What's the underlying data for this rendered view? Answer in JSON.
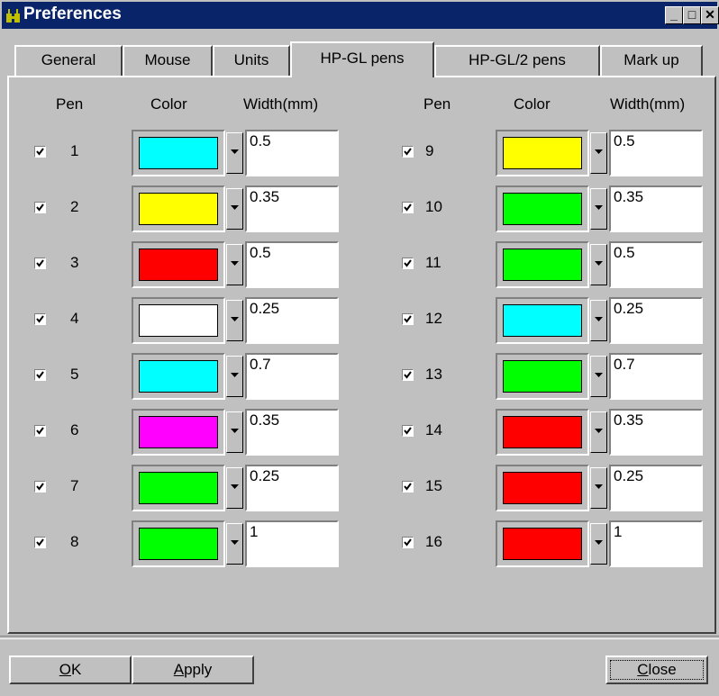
{
  "window": {
    "title": "Preferences"
  },
  "title_buttons": {
    "minimize": "_",
    "maximize": "□",
    "close": "✕"
  },
  "tabs": [
    {
      "label": "General",
      "active": false
    },
    {
      "label": "Mouse",
      "active": false
    },
    {
      "label": "Units",
      "active": false
    },
    {
      "label": "HP-GL pens",
      "active": true
    },
    {
      "label": "HP-GL/2 pens",
      "active": false
    },
    {
      "label": "Mark up",
      "active": false
    }
  ],
  "headers": {
    "pen": "Pen",
    "color": "Color",
    "width": "Width(mm)"
  },
  "pens_left": [
    {
      "num": "1",
      "checked": true,
      "color": "#00ffff",
      "width": "0.5"
    },
    {
      "num": "2",
      "checked": true,
      "color": "#ffff00",
      "width": "0.35"
    },
    {
      "num": "3",
      "checked": true,
      "color": "#ff0000",
      "width": "0.5"
    },
    {
      "num": "4",
      "checked": true,
      "color": "#ffffff",
      "width": "0.25"
    },
    {
      "num": "5",
      "checked": true,
      "color": "#00ffff",
      "width": "0.7"
    },
    {
      "num": "6",
      "checked": true,
      "color": "#ff00ff",
      "width": "0.35"
    },
    {
      "num": "7",
      "checked": true,
      "color": "#00ff00",
      "width": "0.25"
    },
    {
      "num": "8",
      "checked": true,
      "color": "#00ff00",
      "width": "1"
    }
  ],
  "pens_right": [
    {
      "num": "9",
      "checked": true,
      "color": "#ffff00",
      "width": "0.5"
    },
    {
      "num": "10",
      "checked": true,
      "color": "#00ff00",
      "width": "0.35"
    },
    {
      "num": "11",
      "checked": true,
      "color": "#00ff00",
      "width": "0.5"
    },
    {
      "num": "12",
      "checked": true,
      "color": "#00ffff",
      "width": "0.25"
    },
    {
      "num": "13",
      "checked": true,
      "color": "#00ff00",
      "width": "0.7"
    },
    {
      "num": "14",
      "checked": true,
      "color": "#ff0000",
      "width": "0.35"
    },
    {
      "num": "15",
      "checked": true,
      "color": "#ff0000",
      "width": "0.25"
    },
    {
      "num": "16",
      "checked": true,
      "color": "#ff0000",
      "width": "1"
    }
  ],
  "buttons": {
    "ok": {
      "accel": "O",
      "rest": "K"
    },
    "apply": {
      "accel": "A",
      "rest": "pply"
    },
    "close": {
      "accel": "C",
      "rest": "lose"
    }
  }
}
